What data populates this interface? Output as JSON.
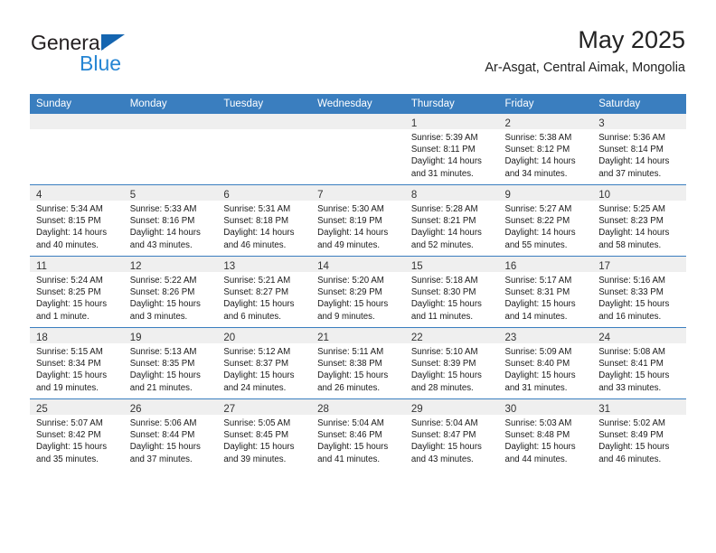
{
  "brand": {
    "name_part1": "General",
    "name_part2": "Blue",
    "accent_color": "#2585d3",
    "triangle_color": "#1565b0"
  },
  "header": {
    "title": "May 2025",
    "subtitle": "Ar-Asgat, Central Aimak, Mongolia"
  },
  "calendar": {
    "header_bg": "#3a7ebf",
    "daynum_bg": "#efefef",
    "weekdays": [
      "Sunday",
      "Monday",
      "Tuesday",
      "Wednesday",
      "Thursday",
      "Friday",
      "Saturday"
    ],
    "weeks": [
      [
        {
          "day": "",
          "lines": []
        },
        {
          "day": "",
          "lines": []
        },
        {
          "day": "",
          "lines": []
        },
        {
          "day": "",
          "lines": []
        },
        {
          "day": "1",
          "lines": [
            "Sunrise: 5:39 AM",
            "Sunset: 8:11 PM",
            "Daylight: 14 hours",
            "and 31 minutes."
          ]
        },
        {
          "day": "2",
          "lines": [
            "Sunrise: 5:38 AM",
            "Sunset: 8:12 PM",
            "Daylight: 14 hours",
            "and 34 minutes."
          ]
        },
        {
          "day": "3",
          "lines": [
            "Sunrise: 5:36 AM",
            "Sunset: 8:14 PM",
            "Daylight: 14 hours",
            "and 37 minutes."
          ]
        }
      ],
      [
        {
          "day": "4",
          "lines": [
            "Sunrise: 5:34 AM",
            "Sunset: 8:15 PM",
            "Daylight: 14 hours",
            "and 40 minutes."
          ]
        },
        {
          "day": "5",
          "lines": [
            "Sunrise: 5:33 AM",
            "Sunset: 8:16 PM",
            "Daylight: 14 hours",
            "and 43 minutes."
          ]
        },
        {
          "day": "6",
          "lines": [
            "Sunrise: 5:31 AM",
            "Sunset: 8:18 PM",
            "Daylight: 14 hours",
            "and 46 minutes."
          ]
        },
        {
          "day": "7",
          "lines": [
            "Sunrise: 5:30 AM",
            "Sunset: 8:19 PM",
            "Daylight: 14 hours",
            "and 49 minutes."
          ]
        },
        {
          "day": "8",
          "lines": [
            "Sunrise: 5:28 AM",
            "Sunset: 8:21 PM",
            "Daylight: 14 hours",
            "and 52 minutes."
          ]
        },
        {
          "day": "9",
          "lines": [
            "Sunrise: 5:27 AM",
            "Sunset: 8:22 PM",
            "Daylight: 14 hours",
            "and 55 minutes."
          ]
        },
        {
          "day": "10",
          "lines": [
            "Sunrise: 5:25 AM",
            "Sunset: 8:23 PM",
            "Daylight: 14 hours",
            "and 58 minutes."
          ]
        }
      ],
      [
        {
          "day": "11",
          "lines": [
            "Sunrise: 5:24 AM",
            "Sunset: 8:25 PM",
            "Daylight: 15 hours",
            "and 1 minute."
          ]
        },
        {
          "day": "12",
          "lines": [
            "Sunrise: 5:22 AM",
            "Sunset: 8:26 PM",
            "Daylight: 15 hours",
            "and 3 minutes."
          ]
        },
        {
          "day": "13",
          "lines": [
            "Sunrise: 5:21 AM",
            "Sunset: 8:27 PM",
            "Daylight: 15 hours",
            "and 6 minutes."
          ]
        },
        {
          "day": "14",
          "lines": [
            "Sunrise: 5:20 AM",
            "Sunset: 8:29 PM",
            "Daylight: 15 hours",
            "and 9 minutes."
          ]
        },
        {
          "day": "15",
          "lines": [
            "Sunrise: 5:18 AM",
            "Sunset: 8:30 PM",
            "Daylight: 15 hours",
            "and 11 minutes."
          ]
        },
        {
          "day": "16",
          "lines": [
            "Sunrise: 5:17 AM",
            "Sunset: 8:31 PM",
            "Daylight: 15 hours",
            "and 14 minutes."
          ]
        },
        {
          "day": "17",
          "lines": [
            "Sunrise: 5:16 AM",
            "Sunset: 8:33 PM",
            "Daylight: 15 hours",
            "and 16 minutes."
          ]
        }
      ],
      [
        {
          "day": "18",
          "lines": [
            "Sunrise: 5:15 AM",
            "Sunset: 8:34 PM",
            "Daylight: 15 hours",
            "and 19 minutes."
          ]
        },
        {
          "day": "19",
          "lines": [
            "Sunrise: 5:13 AM",
            "Sunset: 8:35 PM",
            "Daylight: 15 hours",
            "and 21 minutes."
          ]
        },
        {
          "day": "20",
          "lines": [
            "Sunrise: 5:12 AM",
            "Sunset: 8:37 PM",
            "Daylight: 15 hours",
            "and 24 minutes."
          ]
        },
        {
          "day": "21",
          "lines": [
            "Sunrise: 5:11 AM",
            "Sunset: 8:38 PM",
            "Daylight: 15 hours",
            "and 26 minutes."
          ]
        },
        {
          "day": "22",
          "lines": [
            "Sunrise: 5:10 AM",
            "Sunset: 8:39 PM",
            "Daylight: 15 hours",
            "and 28 minutes."
          ]
        },
        {
          "day": "23",
          "lines": [
            "Sunrise: 5:09 AM",
            "Sunset: 8:40 PM",
            "Daylight: 15 hours",
            "and 31 minutes."
          ]
        },
        {
          "day": "24",
          "lines": [
            "Sunrise: 5:08 AM",
            "Sunset: 8:41 PM",
            "Daylight: 15 hours",
            "and 33 minutes."
          ]
        }
      ],
      [
        {
          "day": "25",
          "lines": [
            "Sunrise: 5:07 AM",
            "Sunset: 8:42 PM",
            "Daylight: 15 hours",
            "and 35 minutes."
          ]
        },
        {
          "day": "26",
          "lines": [
            "Sunrise: 5:06 AM",
            "Sunset: 8:44 PM",
            "Daylight: 15 hours",
            "and 37 minutes."
          ]
        },
        {
          "day": "27",
          "lines": [
            "Sunrise: 5:05 AM",
            "Sunset: 8:45 PM",
            "Daylight: 15 hours",
            "and 39 minutes."
          ]
        },
        {
          "day": "28",
          "lines": [
            "Sunrise: 5:04 AM",
            "Sunset: 8:46 PM",
            "Daylight: 15 hours",
            "and 41 minutes."
          ]
        },
        {
          "day": "29",
          "lines": [
            "Sunrise: 5:04 AM",
            "Sunset: 8:47 PM",
            "Daylight: 15 hours",
            "and 43 minutes."
          ]
        },
        {
          "day": "30",
          "lines": [
            "Sunrise: 5:03 AM",
            "Sunset: 8:48 PM",
            "Daylight: 15 hours",
            "and 44 minutes."
          ]
        },
        {
          "day": "31",
          "lines": [
            "Sunrise: 5:02 AM",
            "Sunset: 8:49 PM",
            "Daylight: 15 hours",
            "and 46 minutes."
          ]
        }
      ]
    ]
  }
}
